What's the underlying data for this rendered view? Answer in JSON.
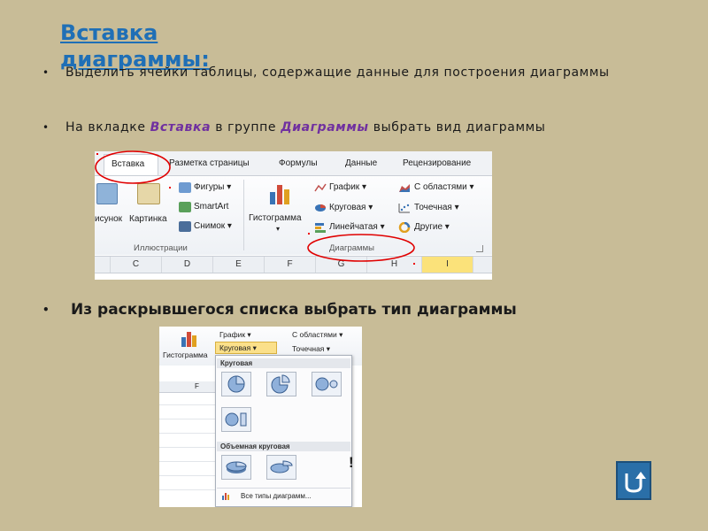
{
  "title": "Вставка диаграммы:",
  "bullets": {
    "b1_text": "Выделить ячейки таблицы, содержащие данные для построения диаграммы",
    "b2_prefix": "На вкладке ",
    "b2_kw1": "Вставка",
    "b2_mid": " в группе ",
    "b2_kw2": "Диаграммы",
    "b2_suffix": " выбрать вид диаграммы",
    "b3_text": "Из раскрывшегося списка выбрать тип диаграммы",
    "bullet_symbol": "•"
  },
  "ribbon": {
    "tabs": [
      "Вставка",
      "Разметка страницы",
      "Формулы",
      "Данные",
      "Рецензирование"
    ],
    "illustrations": {
      "picture": "исунок",
      "clipart": "Картинка",
      "shapes": "Фигуры ▾",
      "smartart": "SmartArt",
      "screenshot": "Снимок ▾",
      "group_label": "Иллюстрации"
    },
    "charts": {
      "histogram": "Гистограмма",
      "histogram_arrow": "▾",
      "line": "График ▾",
      "pie": "Круговая ▾",
      "bar": "Линейчатая ▾",
      "area": "С областями ▾",
      "scatter": "Точечная ▾",
      "other": "Другие ▾",
      "group_label": "Диаграммы"
    },
    "columns": [
      "C",
      "D",
      "E",
      "F",
      "G",
      "H",
      "I"
    ]
  },
  "dropdown": {
    "histogram": "Гистограмма",
    "line": "График ▾",
    "pie": "Круговая ▾",
    "area": "С областями ▾",
    "scatter": "Точечная ▾",
    "col_f": "F",
    "section_pie": "Круговая",
    "section_3d": "Объемная круговая",
    "all_types": "Все типы диаграмм...",
    "stray_char": "!"
  },
  "colors": {
    "background": "#c8bc97",
    "title": "#1f6fb6",
    "keyword": "#7030a0",
    "highlight_oval": "#e00000"
  },
  "icons": {
    "nav_button": "return-arrow-icon"
  }
}
